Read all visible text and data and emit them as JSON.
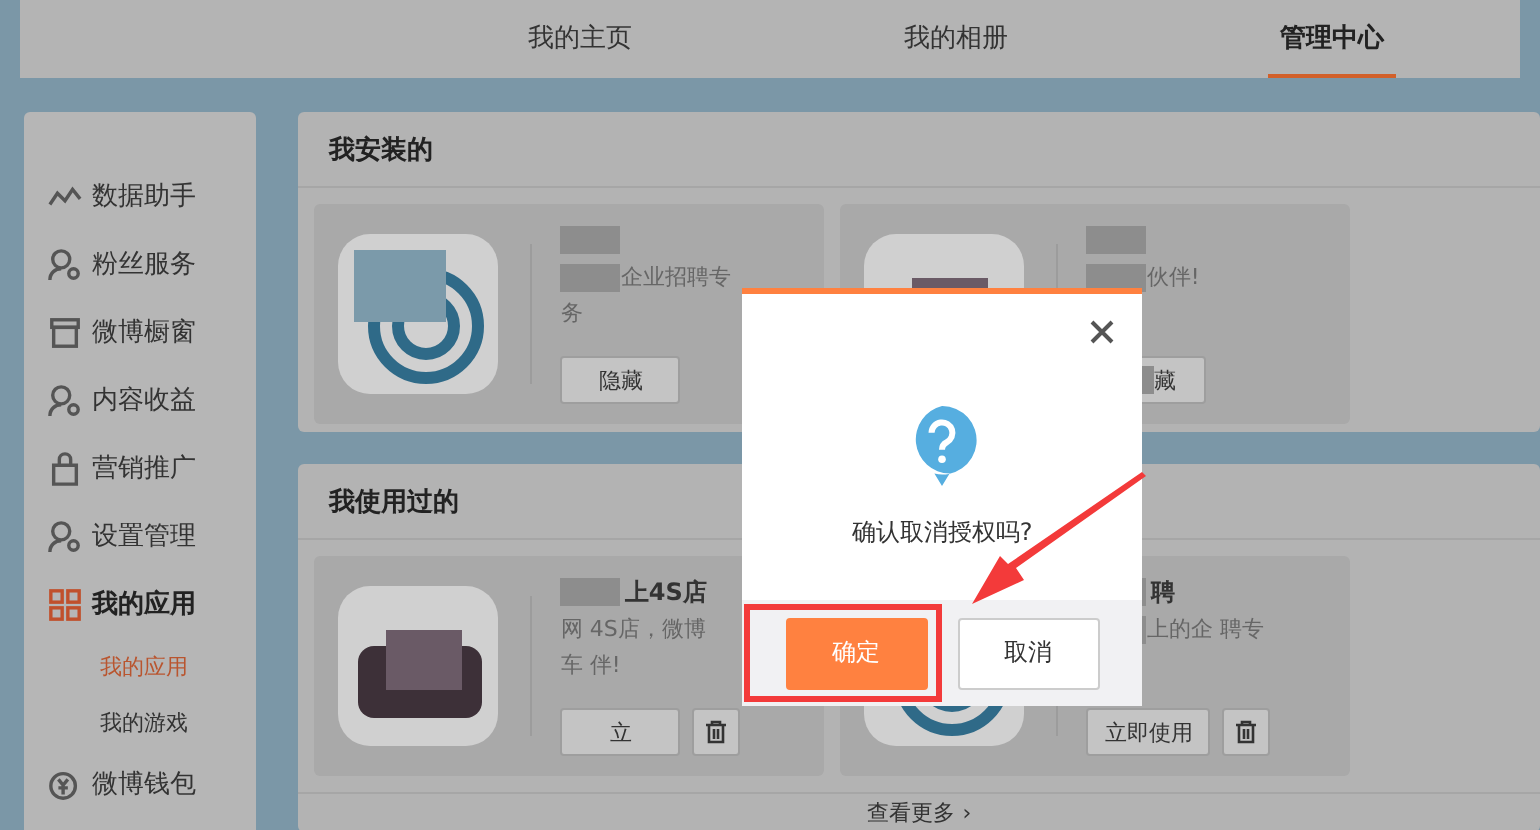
{
  "nav": {
    "tabs": [
      {
        "label": "我的主页",
        "selected": false
      },
      {
        "label": "我的相册",
        "selected": false
      },
      {
        "label": "管理中心",
        "selected": true
      }
    ]
  },
  "sidebar": {
    "items": [
      {
        "label": "数据助手",
        "selected": false
      },
      {
        "label": "粉丝服务",
        "selected": false
      },
      {
        "label": "微博橱窗",
        "selected": false
      },
      {
        "label": "内容收益",
        "selected": false
      },
      {
        "label": "营销推广",
        "selected": false
      },
      {
        "label": "设置管理",
        "selected": false
      },
      {
        "label": "我的应用",
        "selected": true,
        "children": [
          {
            "label": "我的应用",
            "selected": true
          },
          {
            "label": "我的游戏",
            "selected": false
          }
        ]
      },
      {
        "label": "微博钱包",
        "selected": false
      }
    ]
  },
  "sections": [
    {
      "title": "我安装的",
      "cards": [
        {
          "kind": "target",
          "lines": [
            {
              "text": "企业招聘专",
              "masked": true
            },
            {
              "text": "务",
              "masked": false
            }
          ],
          "buttons": [
            {
              "kind": "text",
              "label": "隐藏",
              "masked": false
            }
          ]
        },
        {
          "kind": "dark",
          "lines": [
            {
              "text": "伙伴!",
              "masked": true
            }
          ],
          "buttons": [
            {
              "kind": "text",
              "label": "藏",
              "masked": true
            }
          ]
        }
      ]
    },
    {
      "title": "我使用过的",
      "cards": [
        {
          "kind": "dark",
          "title": "上4S店",
          "lines": [
            {
              "text": "网 4S店，微博",
              "masked": false
            },
            {
              "text": "车 伴!",
              "masked": false
            }
          ],
          "buttons": [
            {
              "kind": "text",
              "label": "立",
              "masked": false
            },
            {
              "kind": "trash"
            }
          ]
        },
        {
          "kind": "target",
          "title": "聘",
          "lines": [
            {
              "text": "上的企 聘专",
              "masked": true
            }
          ],
          "buttons": [
            {
              "kind": "text",
              "label": "立即使用",
              "masked": false
            },
            {
              "kind": "trash"
            }
          ]
        }
      ],
      "more": "查看更多 ›"
    }
  ],
  "dialog": {
    "message": "确认取消授权吗?",
    "buttons": [
      {
        "label": "确定",
        "kind": "primary"
      },
      {
        "label": "取消",
        "kind": "secondary"
      }
    ]
  }
}
